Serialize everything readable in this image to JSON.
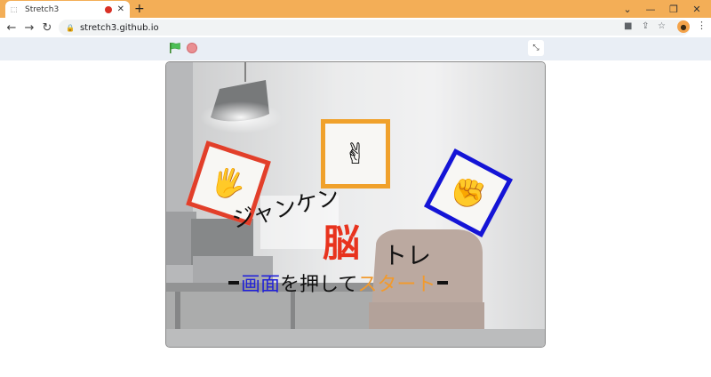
{
  "browser": {
    "tab_title": "Stretch3",
    "new_tab": "+",
    "url": "stretch3.github.io",
    "window_controls": [
      "chevron-down-icon",
      "minimize-icon",
      "restore-icon",
      "close-icon"
    ]
  },
  "app": {
    "controls": [
      "green-flag-icon",
      "stop-icon",
      "exit-fullscreen-icon"
    ],
    "stage": {
      "cards": [
        {
          "name": "paper",
          "icon": "open-hand-icon",
          "color": "#e23f2a"
        },
        {
          "name": "scissors",
          "icon": "peace-hand-icon",
          "color": "#f0a12b"
        },
        {
          "name": "rock",
          "icon": "fist-icon",
          "color": "#1414d6"
        }
      ],
      "title_part1": "ジャンケン",
      "title_part2": "脳",
      "title_part3": "トレ",
      "subtitle_part1": "画面",
      "subtitle_part2": "を押して",
      "subtitle_part3": "スタート",
      "colors": {
        "red": "#e8331e",
        "blue": "#2222d8",
        "orange": "#f19a2e"
      }
    }
  }
}
